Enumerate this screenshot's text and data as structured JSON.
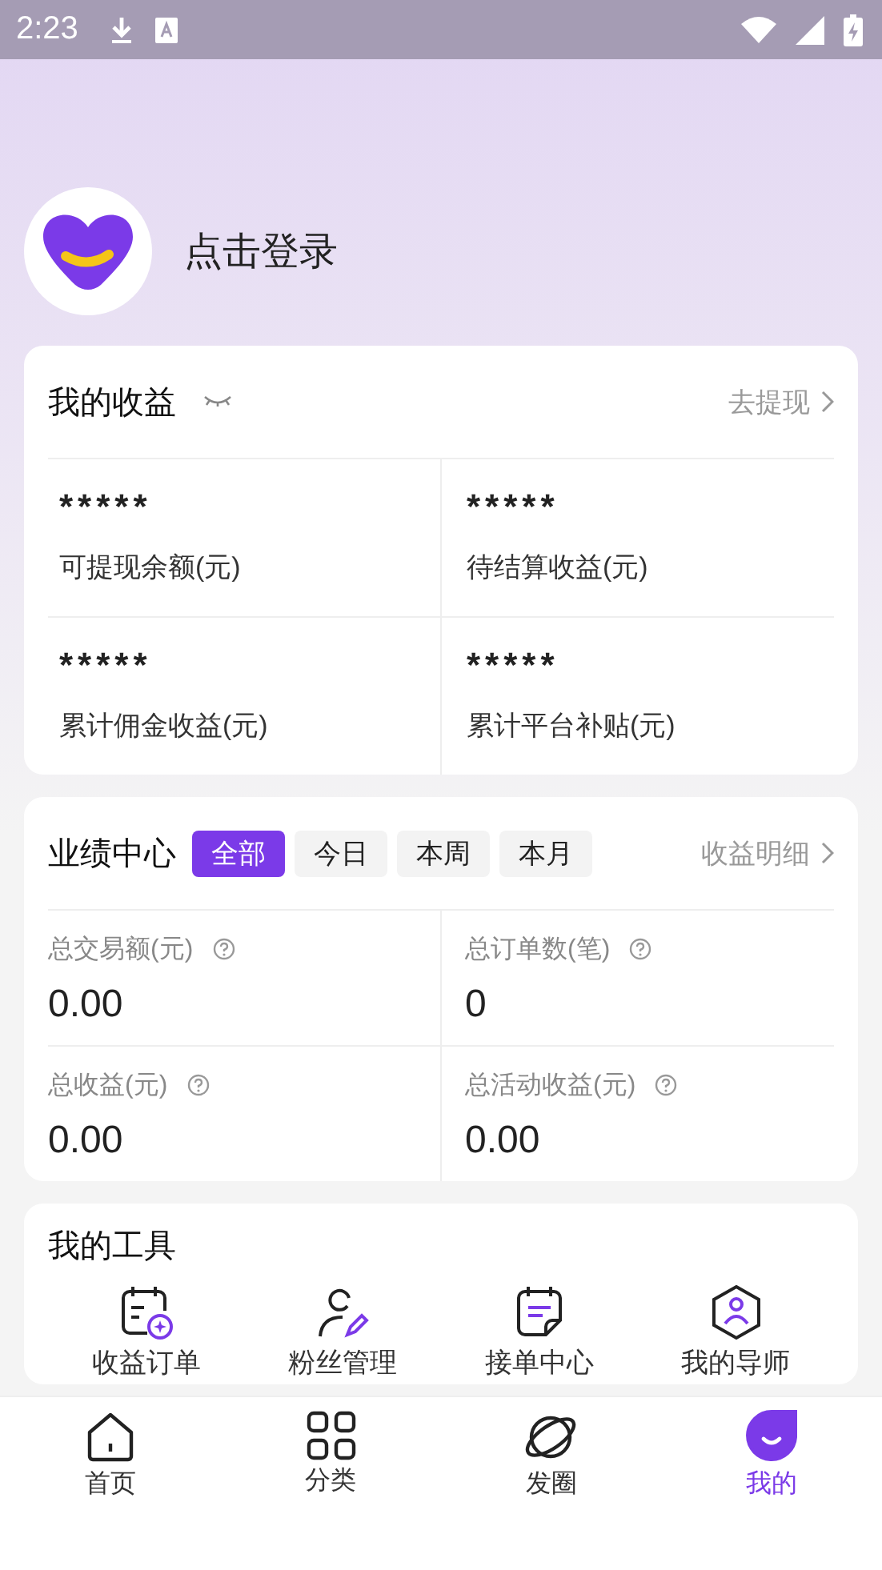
{
  "status_bar": {
    "time": "2:23"
  },
  "profile": {
    "login": "点击登录"
  },
  "earnings": {
    "title": "我的收益",
    "hidden": true,
    "action": "去提现",
    "cells": [
      {
        "value": "*****",
        "label": "可提现余额(元)"
      },
      {
        "value": "*****",
        "label": "待结算收益(元)"
      },
      {
        "value": "*****",
        "label": "累计佣金收益(元)"
      },
      {
        "value": "*****",
        "label": "累计平台补贴(元)"
      }
    ]
  },
  "performance": {
    "title": "业绩中心",
    "tabs": [
      {
        "label": "全部",
        "selected": true
      },
      {
        "label": "今日",
        "selected": false
      },
      {
        "label": "本周",
        "selected": false
      },
      {
        "label": "本月",
        "selected": false
      }
    ],
    "action": "收益明细",
    "stats": [
      {
        "label": "总交易额(元)",
        "value": "0.00"
      },
      {
        "label": "总订单数(笔)",
        "value": "0"
      },
      {
        "label": "总收益(元)",
        "value": "0.00"
      },
      {
        "label": "总活动收益(元)",
        "value": "0.00"
      }
    ]
  },
  "tools": {
    "title": "我的工具",
    "items": [
      {
        "label": "收益订单",
        "kind": "order"
      },
      {
        "label": "粉丝管理",
        "kind": "fans"
      },
      {
        "label": "接单中心",
        "kind": "note"
      },
      {
        "label": "我的导师",
        "kind": "mentor"
      }
    ]
  },
  "nav": [
    {
      "label": "首页",
      "kind": "home",
      "selected": false
    },
    {
      "label": "分类",
      "kind": "grid",
      "selected": false
    },
    {
      "label": "发圈",
      "kind": "planet",
      "selected": false
    },
    {
      "label": "我的",
      "kind": "me",
      "selected": true
    }
  ]
}
